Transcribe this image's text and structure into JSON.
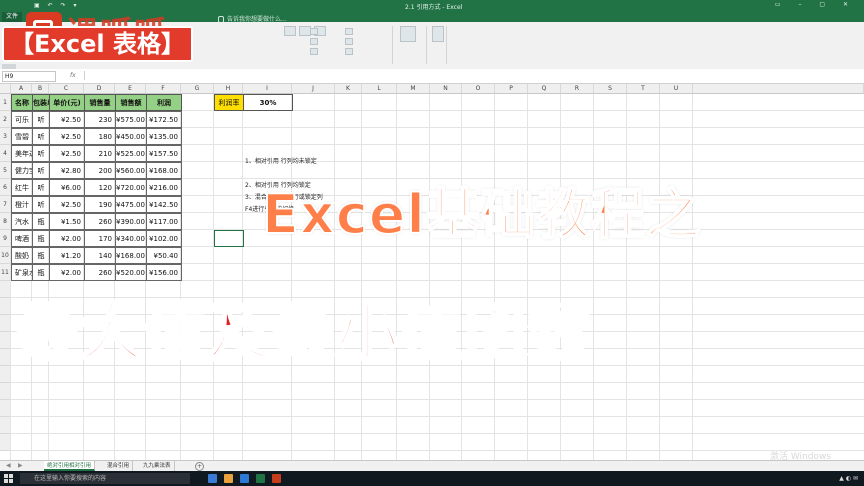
{
  "window": {
    "title": "2.1 引用方式 - Excel",
    "file_tab": "文件",
    "tell_me": "告诉我你想要做什么..."
  },
  "name_box": "H9",
  "fx_label": "fx",
  "columns": [
    "A",
    "B",
    "C",
    "D",
    "E",
    "F",
    "G",
    "H",
    "I",
    "J",
    "K",
    "L",
    "M",
    "N",
    "O",
    "P",
    "Q",
    "R",
    "S",
    "T",
    "U"
  ],
  "rows": [
    "1",
    "2",
    "3",
    "4",
    "5",
    "6",
    "7",
    "8",
    "9",
    "10",
    "11"
  ],
  "table": {
    "headers": [
      "名称",
      "包装单位",
      "单价(元)",
      "销售量",
      "销售额",
      "利润"
    ],
    "rows": [
      [
        "可乐",
        "听",
        "¥2.50",
        "230",
        "¥575.00",
        "¥172.50"
      ],
      [
        "雪碧",
        "听",
        "¥2.50",
        "180",
        "¥450.00",
        "¥135.00"
      ],
      [
        "美年达",
        "听",
        "¥2.50",
        "210",
        "¥525.00",
        "¥157.50"
      ],
      [
        "健力宝",
        "听",
        "¥2.80",
        "200",
        "¥560.00",
        "¥168.00"
      ],
      [
        "红牛",
        "听",
        "¥6.00",
        "120",
        "¥720.00",
        "¥216.00"
      ],
      [
        "橙汁",
        "听",
        "¥2.50",
        "190",
        "¥475.00",
        "¥142.50"
      ],
      [
        "汽水",
        "瓶",
        "¥1.50",
        "260",
        "¥390.00",
        "¥117.00"
      ],
      [
        "啤酒",
        "瓶",
        "¥2.00",
        "170",
        "¥340.00",
        "¥102.00"
      ],
      [
        "酸奶",
        "瓶",
        "¥1.20",
        "140",
        "¥168.00",
        "¥50.40"
      ],
      [
        "矿泉水",
        "瓶",
        "¥2.00",
        "260",
        "¥520.00",
        "¥156.00"
      ]
    ]
  },
  "profit_rate": {
    "label": "利润率",
    "value": "30%"
  },
  "notes": [
    "1、相对引用 行列均未锁定",
    "2、相对引用 行列均锁定",
    "3、混合引用 锁定行或锁定列",
    "F4进行引用的切换"
  ],
  "sheets": [
    "绝对引用相对引用",
    "混合引用",
    "九九乘法表"
  ],
  "active_sheet": 0,
  "taskbar": {
    "search_placeholder": "在这里输入你要搜索的内容"
  },
  "watermark": "激活 Windows",
  "overlay": {
    "logo_text": "课呱呱",
    "tag": "【Excel 表格】",
    "headline_1": "Excel基础教程之",
    "headline_2": "最大值及最小值函数"
  },
  "colors": {
    "excel_green": "#217346",
    "header_fill": "#94d085",
    "highlight_yellow": "#ffdf00",
    "headline_orange": "#ff7f4a",
    "headline_red": "#e61d1d"
  }
}
